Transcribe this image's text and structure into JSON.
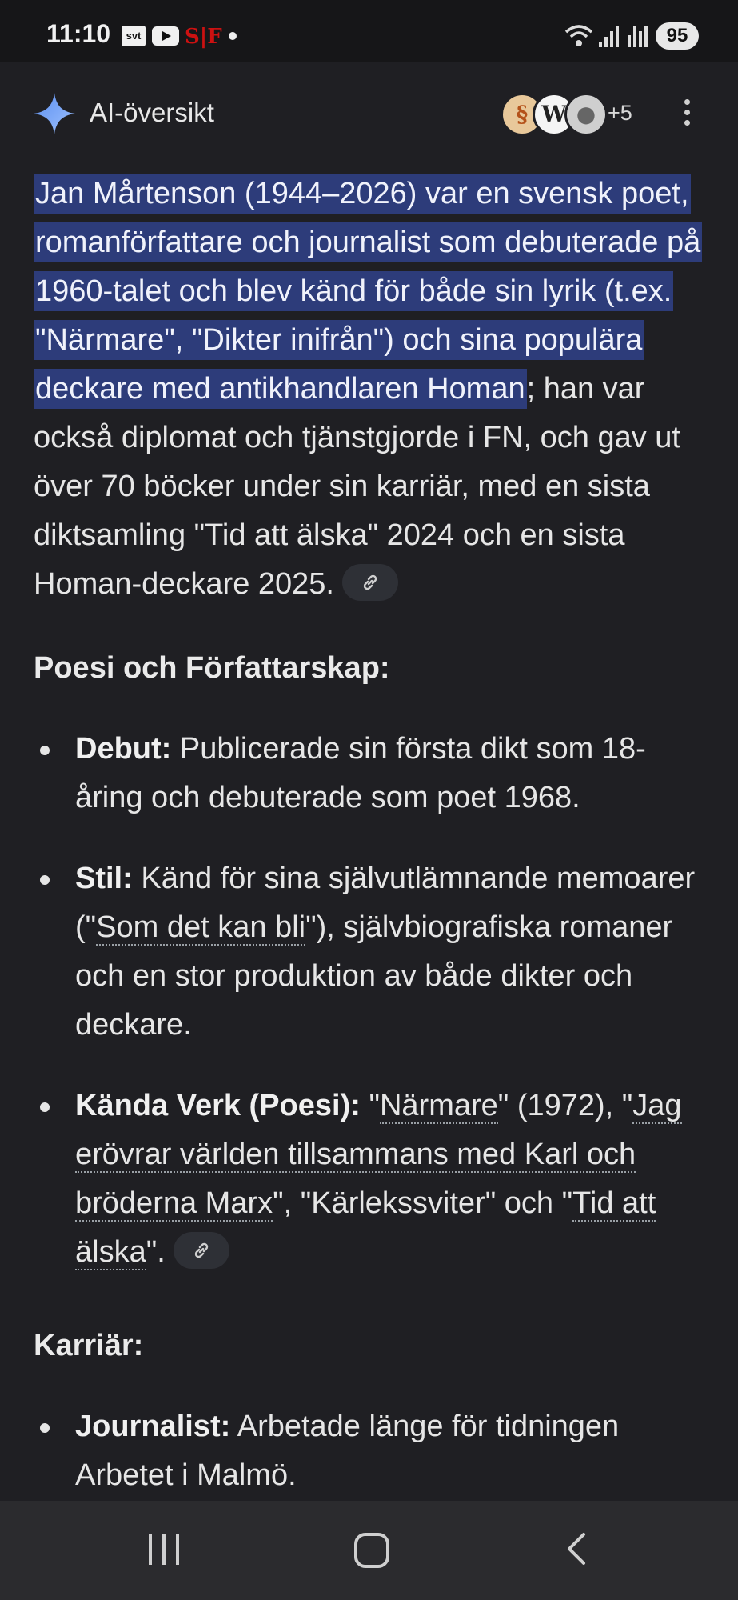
{
  "status_bar": {
    "time": "11:10",
    "svt_label": "svt",
    "sf_label": "S|F",
    "battery": "95"
  },
  "header": {
    "title": "AI-översikt",
    "source_more": "+5",
    "icons": [
      "sparkle-icon",
      "source-favicons",
      "more-vert-icon"
    ]
  },
  "intro": {
    "highlighted": "Jan Mårtenson (1944–2026) var en svensk poet, romanförfattare och journalist som debuterade på 1960-talet och blev känd för både sin lyrik (t.ex. \"Närmare\", \"Dikter inifrån\") och sina populära deckare med antikhandlaren Homan",
    "rest": "; han var också diplomat och tjänstgjorde i FN, och gav ut över 70 böcker under sin karriär, med en sista diktsamling \"Tid att älska\" 2024 och en sista Homan-deckare 2025."
  },
  "section_poetry": {
    "heading": "Poesi och Författarskap:",
    "items": [
      {
        "label": "Debut:",
        "text": "Publicerade sin första dikt som 18-åring och debuterade som poet 1968."
      },
      {
        "label": "Stil:",
        "text_before": "Känd för sina självutlämnande memoarer (\"",
        "link": "Som det kan bli",
        "text_after": "\"), självbiografiska romaner och en stor produktion av både dikter och deckare."
      },
      {
        "label": "Kända Verk (Poesi):",
        "q1": "\"",
        "link1": "Närmare",
        "mid1": "\" (1972), \"",
        "link2": "Jag erövrar världen tillsammans med Karl och bröderna Marx",
        "mid2": "\", \"Kärlekssviter\" och \"",
        "link3": "Tid att älska",
        "end": "\"."
      }
    ]
  },
  "section_career": {
    "heading": "Karriär:",
    "items": [
      {
        "label": "Journalist:",
        "text": "Arbetade länge för tidningen Arbetet i Malmö."
      }
    ]
  }
}
